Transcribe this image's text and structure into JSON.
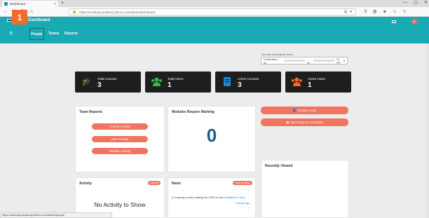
{
  "browser": {
    "tab_title": "Dashboard",
    "tab_close": "×",
    "new_tab": "+",
    "window_controls": [
      "—",
      "▢",
      "✕"
    ],
    "nav_buttons": [
      "←",
      "→",
      "↻",
      "⌂"
    ],
    "url": "https://workbay.academy.litmos.com/admin/dashboard",
    "status_url": "https://workbay.academy.litmos.com/admin/people"
  },
  "app": {
    "title": "Dashboard",
    "nav": {
      "d": "D",
      "people": "People",
      "teams": "Teams",
      "reports": "Reports"
    },
    "step_badge": "1",
    "avatar_initial": "N",
    "accent_color": "#19aab3",
    "button_color": "#f07461"
  },
  "team_selector": {
    "label": "You are viewing the team",
    "prefix": "Customers - Ar",
    "middle": "- Ar",
    "suffix": "% PP"
  },
  "stats": [
    {
      "label": "Total Courses",
      "value": "3",
      "icon": "graduation-cap-icon",
      "color": "#c23ea4"
    },
    {
      "label": "Total Users",
      "value": "1",
      "icon": "users-icon",
      "color": "#3db34a"
    },
    {
      "label": "Active Courses",
      "value": "3",
      "icon": "book-icon",
      "color": "#1e88d8"
    },
    {
      "label": "Active Users",
      "value": "1",
      "icon": "active-users-icon",
      "color": "#f26b2a"
    }
  ],
  "team_reports": {
    "title": "Team Reports",
    "buttons": [
      "Course Activity",
      "User Activity",
      "Module Activity"
    ]
  },
  "modules": {
    "title": "Modules Require Marking",
    "count": "0"
  },
  "actions": {
    "create_user": "Create a user",
    "ilt_schedule": "Upcoming ILT schedule"
  },
  "recently_viewed": {
    "title": "Recently Viewed"
  },
  "activity": {
    "title": "Activity",
    "view_all": "View All",
    "empty": "No Activity to Show"
  },
  "news": {
    "title": "News",
    "view_all": "View all News",
    "item_text": "A-Training course catalog for 2020 is now",
    "item_link": "available to view.",
    "item_time": "7 months ago",
    "chevron": "›"
  }
}
